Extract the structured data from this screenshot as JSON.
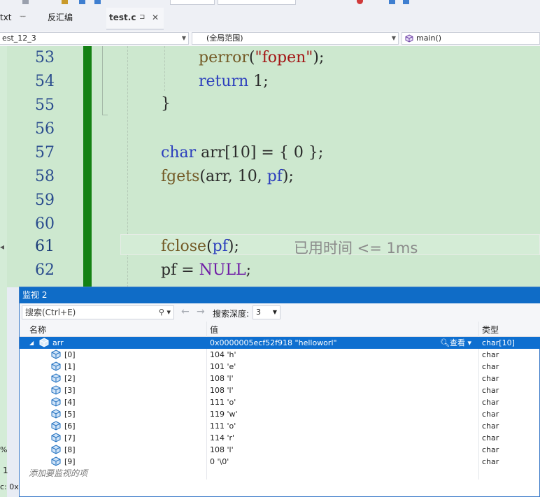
{
  "tabs": {
    "txt_tab": "txt",
    "pin_glyph": "ᅲ",
    "disasm_tab": "反汇编",
    "active_tab": "test.c",
    "active_pin": "⊐",
    "active_close": "✕"
  },
  "navbar": {
    "project": "est_12_3",
    "scope": "(全局范围)",
    "member": "main()"
  },
  "editor": {
    "line_numbers": [
      "53",
      "54",
      "55",
      "56",
      "57",
      "58",
      "59",
      "60",
      "61",
      "62"
    ],
    "lines": {
      "l53": {
        "func": "perror",
        "open": "(",
        "str": "\"fopen\"",
        "close": ");"
      },
      "l54": {
        "kw": "return",
        "rest": " 1;"
      },
      "l55": {
        "text": "}"
      },
      "l57": {
        "kw": "char",
        "rest": " arr[10] = { 0 };"
      },
      "l58": {
        "func": "fgets",
        "p1": "(arr, 10, ",
        "var": "pf",
        "p2": ");"
      },
      "l61": {
        "func": "fclose",
        "p1": "(",
        "var": "pf",
        "p2": ");"
      },
      "l62": {
        "var": "pf",
        "mid": " = ",
        "macro": "NULL",
        "end": ";"
      }
    },
    "elapsed_hint": "已用时间 <= 1ms",
    "left_margin_percent": "%",
    "left_margin_one": "1",
    "left_margin_c": "c: 0x"
  },
  "watch": {
    "title": "监视 2",
    "search_placeholder": "搜索(Ctrl+E)",
    "search_depth_label": "搜索深度:",
    "search_depth_value": "3",
    "columns": {
      "name": "名称",
      "value": "值",
      "type": "类型"
    },
    "root": {
      "name": "arr",
      "value": "0x0000005ecf52f918 \"helloworl\"",
      "view": "查看",
      "type": "char[10]"
    },
    "items": [
      {
        "name": "[0]",
        "value": "104 'h'",
        "type": "char"
      },
      {
        "name": "[1]",
        "value": "101 'e'",
        "type": "char"
      },
      {
        "name": "[2]",
        "value": "108 'l'",
        "type": "char"
      },
      {
        "name": "[3]",
        "value": "108 'l'",
        "type": "char"
      },
      {
        "name": "[4]",
        "value": "111 'o'",
        "type": "char"
      },
      {
        "name": "[5]",
        "value": "119 'w'",
        "type": "char"
      },
      {
        "name": "[6]",
        "value": "111 'o'",
        "type": "char"
      },
      {
        "name": "[7]",
        "value": "114 'r'",
        "type": "char"
      },
      {
        "name": "[8]",
        "value": "108 'l'",
        "type": "char"
      },
      {
        "name": "[9]",
        "value": "0 '\\0'",
        "type": "char"
      }
    ],
    "add_item_placeholder": "添加要监视的项"
  },
  "colors": {
    "accent": "#0e6fd0",
    "editor_bg": "#cde8cf",
    "change_bar": "#148114"
  }
}
